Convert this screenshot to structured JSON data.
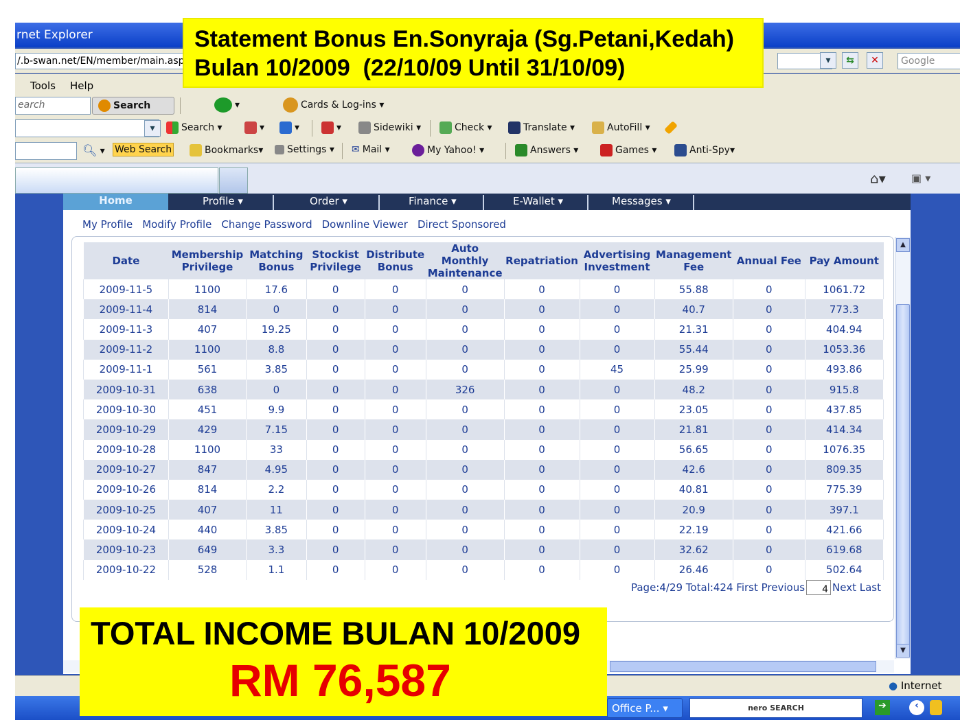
{
  "window": {
    "title": "rnet Explorer",
    "url": "/.b-swan.net/EN/member/main.asp",
    "google_placeholder": "Google"
  },
  "menu": [
    "Tools",
    "Help"
  ],
  "toolbar1": {
    "search_placeholder": "earch",
    "search_btn": "Search",
    "cards": "Cards & Log-ins ▾"
  },
  "toolbar2": {
    "search": "Search ▾",
    "sidewiki": "Sidewiki ▾",
    "check": "Check ▾",
    "translate": "Translate ▾",
    "autofill": "AutoFill ▾"
  },
  "toolbar3": {
    "web_search": "Web Search",
    "bookmarks": "Bookmarks▾",
    "settings": "Settings ▾",
    "mail": "Mail ▾",
    "my_yahoo": "My Yahoo! ▾",
    "answers": "Answers ▾",
    "games": "Games ▾",
    "anti_spy": "Anti-Spy▾"
  },
  "nav": {
    "home": "Home",
    "profile": "Profile ▾",
    "order": "Order ▾",
    "finance": "Finance ▾",
    "ewallet": "E-Wallet ▾",
    "messages": "Messages ▾"
  },
  "sublinks": [
    "My Profile",
    "Modify Profile",
    "Change Password",
    "Downline Viewer",
    "Direct Sponsored"
  ],
  "table": {
    "headers": [
      "Date",
      "Membership Privilege",
      "Matching Bonus",
      "Stockist Privilege",
      "Distribute Bonus",
      "Auto Monthly Maintenance",
      "Repatriation",
      "Advertising Investment",
      "Management Fee",
      "Annual Fee",
      "Pay Amount"
    ],
    "rows": [
      [
        "2009-11-5",
        "1100",
        "17.6",
        "0",
        "0",
        "0",
        "0",
        "0",
        "55.88",
        "0",
        "1061.72"
      ],
      [
        "2009-11-4",
        "814",
        "0",
        "0",
        "0",
        "0",
        "0",
        "0",
        "40.7",
        "0",
        "773.3"
      ],
      [
        "2009-11-3",
        "407",
        "19.25",
        "0",
        "0",
        "0",
        "0",
        "0",
        "21.31",
        "0",
        "404.94"
      ],
      [
        "2009-11-2",
        "1100",
        "8.8",
        "0",
        "0",
        "0",
        "0",
        "0",
        "55.44",
        "0",
        "1053.36"
      ],
      [
        "2009-11-1",
        "561",
        "3.85",
        "0",
        "0",
        "0",
        "0",
        "45",
        "25.99",
        "0",
        "493.86"
      ],
      [
        "2009-10-31",
        "638",
        "0",
        "0",
        "0",
        "326",
        "0",
        "0",
        "48.2",
        "0",
        "915.8"
      ],
      [
        "2009-10-30",
        "451",
        "9.9",
        "0",
        "0",
        "0",
        "0",
        "0",
        "23.05",
        "0",
        "437.85"
      ],
      [
        "2009-10-29",
        "429",
        "7.15",
        "0",
        "0",
        "0",
        "0",
        "0",
        "21.81",
        "0",
        "414.34"
      ],
      [
        "2009-10-28",
        "1100",
        "33",
        "0",
        "0",
        "0",
        "0",
        "0",
        "56.65",
        "0",
        "1076.35"
      ],
      [
        "2009-10-27",
        "847",
        "4.95",
        "0",
        "0",
        "0",
        "0",
        "0",
        "42.6",
        "0",
        "809.35"
      ],
      [
        "2009-10-26",
        "814",
        "2.2",
        "0",
        "0",
        "0",
        "0",
        "0",
        "40.81",
        "0",
        "775.39"
      ],
      [
        "2009-10-25",
        "407",
        "11",
        "0",
        "0",
        "0",
        "0",
        "0",
        "20.9",
        "0",
        "397.1"
      ],
      [
        "2009-10-24",
        "440",
        "3.85",
        "0",
        "0",
        "0",
        "0",
        "0",
        "22.19",
        "0",
        "421.66"
      ],
      [
        "2009-10-23",
        "649",
        "3.3",
        "0",
        "0",
        "0",
        "0",
        "0",
        "32.62",
        "0",
        "619.68"
      ],
      [
        "2009-10-22",
        "528",
        "1.1",
        "0",
        "0",
        "0",
        "0",
        "0",
        "26.46",
        "0",
        "502.64"
      ]
    ]
  },
  "pager": {
    "info": "Page:4/29 Total:424 First Previous",
    "page_value": "4",
    "next": "Next",
    "last": "Last"
  },
  "status": {
    "zone": "Internet"
  },
  "taskbar": {
    "office": "Office P...",
    "nero": "nero SEARCH"
  },
  "banner_top": {
    "line1": "Statement Bonus En.Sonyraja (Sg.Petani,Kedah)",
    "line2": "Bulan 10/2009  (22/10/09 Until 31/10/09)"
  },
  "banner_bottom": {
    "line1": "TOTAL INCOME BULAN 10/2009",
    "line2": "RM 76,587"
  }
}
